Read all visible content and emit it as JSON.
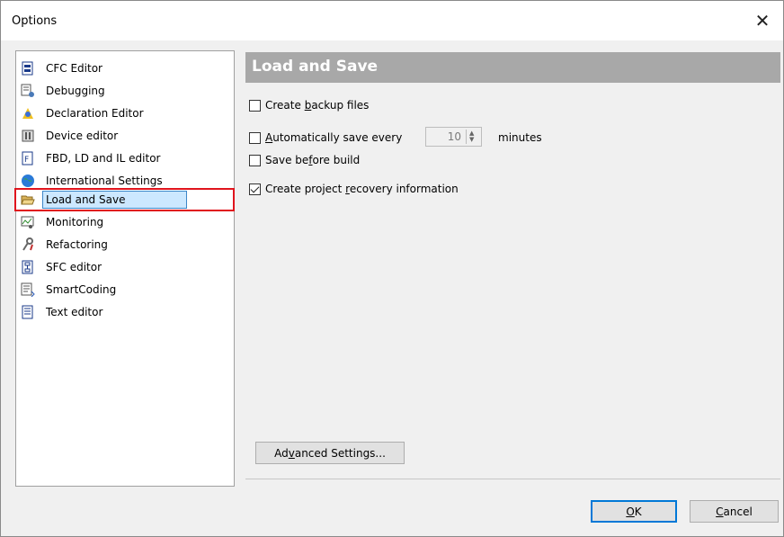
{
  "window": {
    "title": "Options",
    "close_glyph": "✕"
  },
  "sidebar": {
    "items": [
      {
        "label": "CFC Editor",
        "icon": "cfc-editor-icon"
      },
      {
        "label": "Debugging",
        "icon": "debugging-icon"
      },
      {
        "label": "Declaration Editor",
        "icon": "declaration-editor-icon"
      },
      {
        "label": "Device editor",
        "icon": "device-editor-icon"
      },
      {
        "label": "FBD, LD and IL editor",
        "icon": "fbd-ld-il-editor-icon"
      },
      {
        "label": "International Settings",
        "icon": "globe-icon"
      },
      {
        "label": "Load and Save",
        "icon": "folder-open-icon",
        "selected": true
      },
      {
        "label": "Monitoring",
        "icon": "monitoring-icon"
      },
      {
        "label": "Refactoring",
        "icon": "refactoring-icon"
      },
      {
        "label": "SFC editor",
        "icon": "sfc-editor-icon"
      },
      {
        "label": "SmartCoding",
        "icon": "smartcoding-icon"
      },
      {
        "label": "Text editor",
        "icon": "text-editor-icon"
      }
    ]
  },
  "panel": {
    "title": "Load and Save",
    "options": {
      "backup": {
        "pre": "Create ",
        "key": "b",
        "post": "ackup files",
        "checked": false
      },
      "autosave": {
        "pre": "",
        "key": "A",
        "post": "utomatically save every",
        "checked": false
      },
      "before_build": {
        "pre": "Save be",
        "key": "f",
        "post": "ore build",
        "checked": false
      },
      "recovery": {
        "pre": "Create project ",
        "key": "r",
        "post": "ecovery information",
        "checked": true
      }
    },
    "autosave_minutes": "10",
    "minutes_label": "minutes",
    "advanced": {
      "pre": "Ad",
      "key": "v",
      "post": "anced Settings..."
    }
  },
  "footer": {
    "ok": {
      "pre": "",
      "key": "O",
      "post": "K"
    },
    "cancel": {
      "pre": "",
      "key": "C",
      "post": "ancel"
    }
  },
  "colors": {
    "selection_bg": "#cce8ff",
    "highlight_box": "#e0141d",
    "header_bg": "#a8a8a8"
  }
}
